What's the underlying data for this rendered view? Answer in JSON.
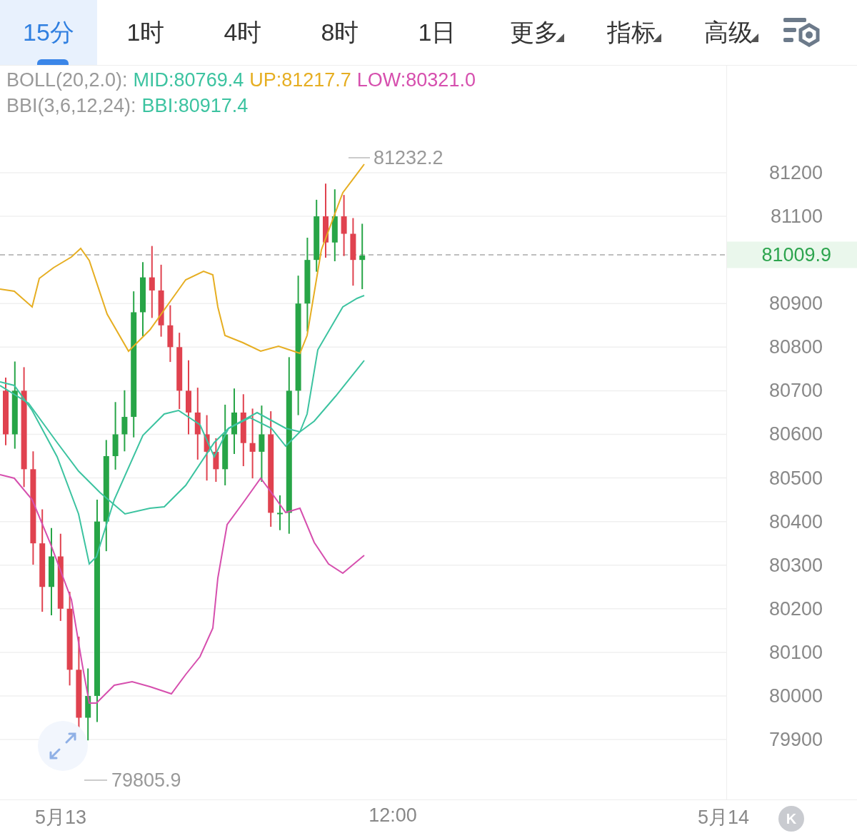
{
  "tabs": [
    {
      "label": "15分",
      "kind": "plain",
      "selected": true
    },
    {
      "label": "1时",
      "kind": "plain",
      "selected": false
    },
    {
      "label": "4时",
      "kind": "plain",
      "selected": false
    },
    {
      "label": "8时",
      "kind": "plain",
      "selected": false
    },
    {
      "label": "1日",
      "kind": "plain",
      "selected": false
    },
    {
      "label": "更多",
      "kind": "dropdown",
      "selected": false
    },
    {
      "label": "指标",
      "kind": "dropdown",
      "selected": false
    },
    {
      "label": "高级",
      "kind": "dropdown",
      "selected": false
    }
  ],
  "legend": [
    {
      "name": "BOLL(20,2.0):",
      "items": [
        {
          "text": "MID:80769.4",
          "color": "#3cc3a0"
        },
        {
          "text": "UP:81217.7",
          "color": "#e6ae22"
        },
        {
          "text": "LOW:80321.0",
          "color": "#d64fae"
        }
      ]
    },
    {
      "name": "BBI(3,6,12,24):",
      "items": [
        {
          "text": "BBI:80917.4",
          "color": "#3cc3a0"
        }
      ]
    }
  ],
  "high_marker": "81232.2",
  "low_marker": "79805.9",
  "price_axis": [
    "81200",
    "81100",
    "80900",
    "80800",
    "80700",
    "80600",
    "80500",
    "80400",
    "80300",
    "80200",
    "80100",
    "80000",
    "79900"
  ],
  "current_price": "81009.9",
  "time_axis": [
    "5月13",
    "12:00",
    "5月14"
  ],
  "k_button": "K"
}
